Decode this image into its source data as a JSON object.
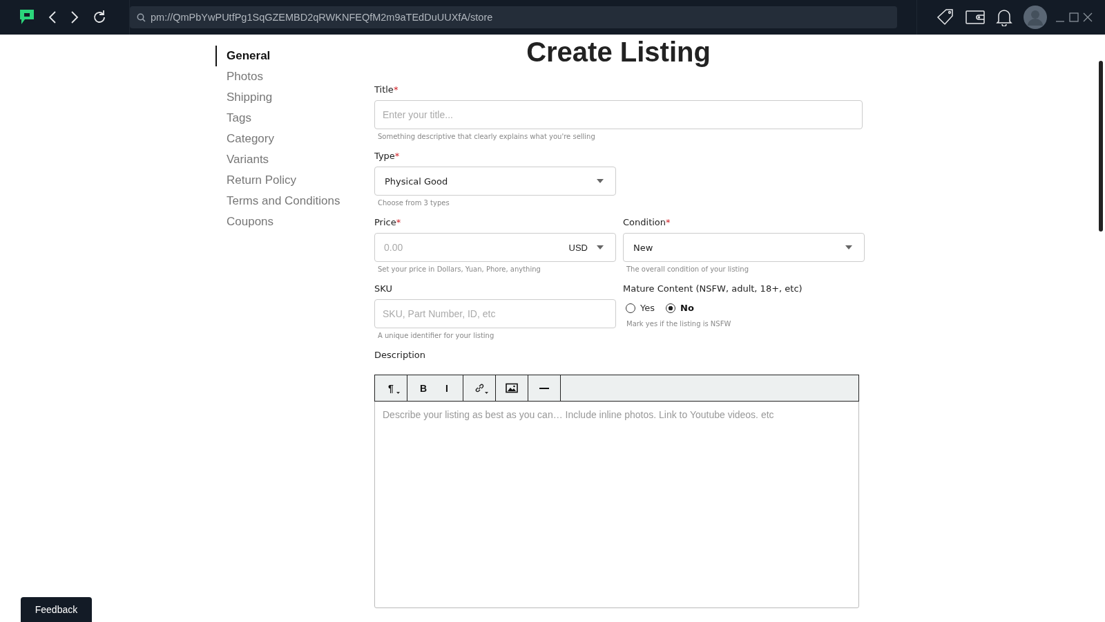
{
  "browser": {
    "url": "pm://QmPbYwPUtfPg1SqGZEMBD2qRWKNFEQfM2m9aTEdDuUUXfA/store"
  },
  "sidebar": {
    "items": [
      {
        "label": "General",
        "selected": true
      },
      {
        "label": "Photos",
        "selected": false
      },
      {
        "label": "Shipping",
        "selected": false
      },
      {
        "label": "Tags",
        "selected": false
      },
      {
        "label": "Category",
        "selected": false
      },
      {
        "label": "Variants",
        "selected": false
      },
      {
        "label": "Return Policy",
        "selected": false
      },
      {
        "label": "Terms and Conditions",
        "selected": false
      },
      {
        "label": "Coupons",
        "selected": false
      }
    ]
  },
  "page_title": "Create Listing",
  "form": {
    "rows": [
      [
        {
          "kind": "input",
          "label": "Title",
          "required_mark": "*",
          "placeholder": "Enter your title...",
          "hint": "Something descriptive that clearly explains what you're selling"
        }
      ],
      [
        {
          "kind": "select",
          "label": "Type",
          "required_mark": "*",
          "value": "Physical Good",
          "hint": "Choose from 3 types"
        },
        {
          "kind": "empty"
        }
      ],
      [
        {
          "kind": "price",
          "label": "Price",
          "required_mark": "*",
          "placeholder": "0.00",
          "currency": "USD",
          "hint": "Set your price in Dollars, Yuan, Phore, anything"
        },
        {
          "kind": "select",
          "label": "Condition",
          "required_mark": "*",
          "value": "New",
          "hint": "The overall condition of your listing"
        }
      ],
      [
        {
          "kind": "input",
          "label": "SKU",
          "placeholder": "SKU, Part Number, ID, etc",
          "hint": "A unique identifier for your listing"
        },
        {
          "kind": "radio",
          "label": "Mature Content (NSFW, adult, 18+, etc)",
          "options": [
            {
              "label": "Yes",
              "selected": false
            },
            {
              "label": "No",
              "selected": true
            }
          ],
          "hint": "Mark yes if the listing is NSFW"
        }
      ]
    ]
  },
  "description": {
    "label": "Description",
    "placeholder": "Describe your listing as best as you can… Include inline photos. Link to Youtube videos. etc",
    "toolbar": [
      [
        {
          "kind": "text",
          "label": "¶",
          "dropdown": true
        }
      ],
      [
        {
          "kind": "text",
          "label": "B",
          "dropdown": false
        },
        {
          "kind": "text",
          "label": "I",
          "dropdown": false
        }
      ],
      [
        {
          "kind": "link",
          "dropdown": true
        }
      ],
      [
        {
          "kind": "image",
          "dropdown": false
        }
      ],
      [
        {
          "kind": "rule",
          "dropdown": false
        }
      ]
    ]
  },
  "feedback_button": "Feedback"
}
